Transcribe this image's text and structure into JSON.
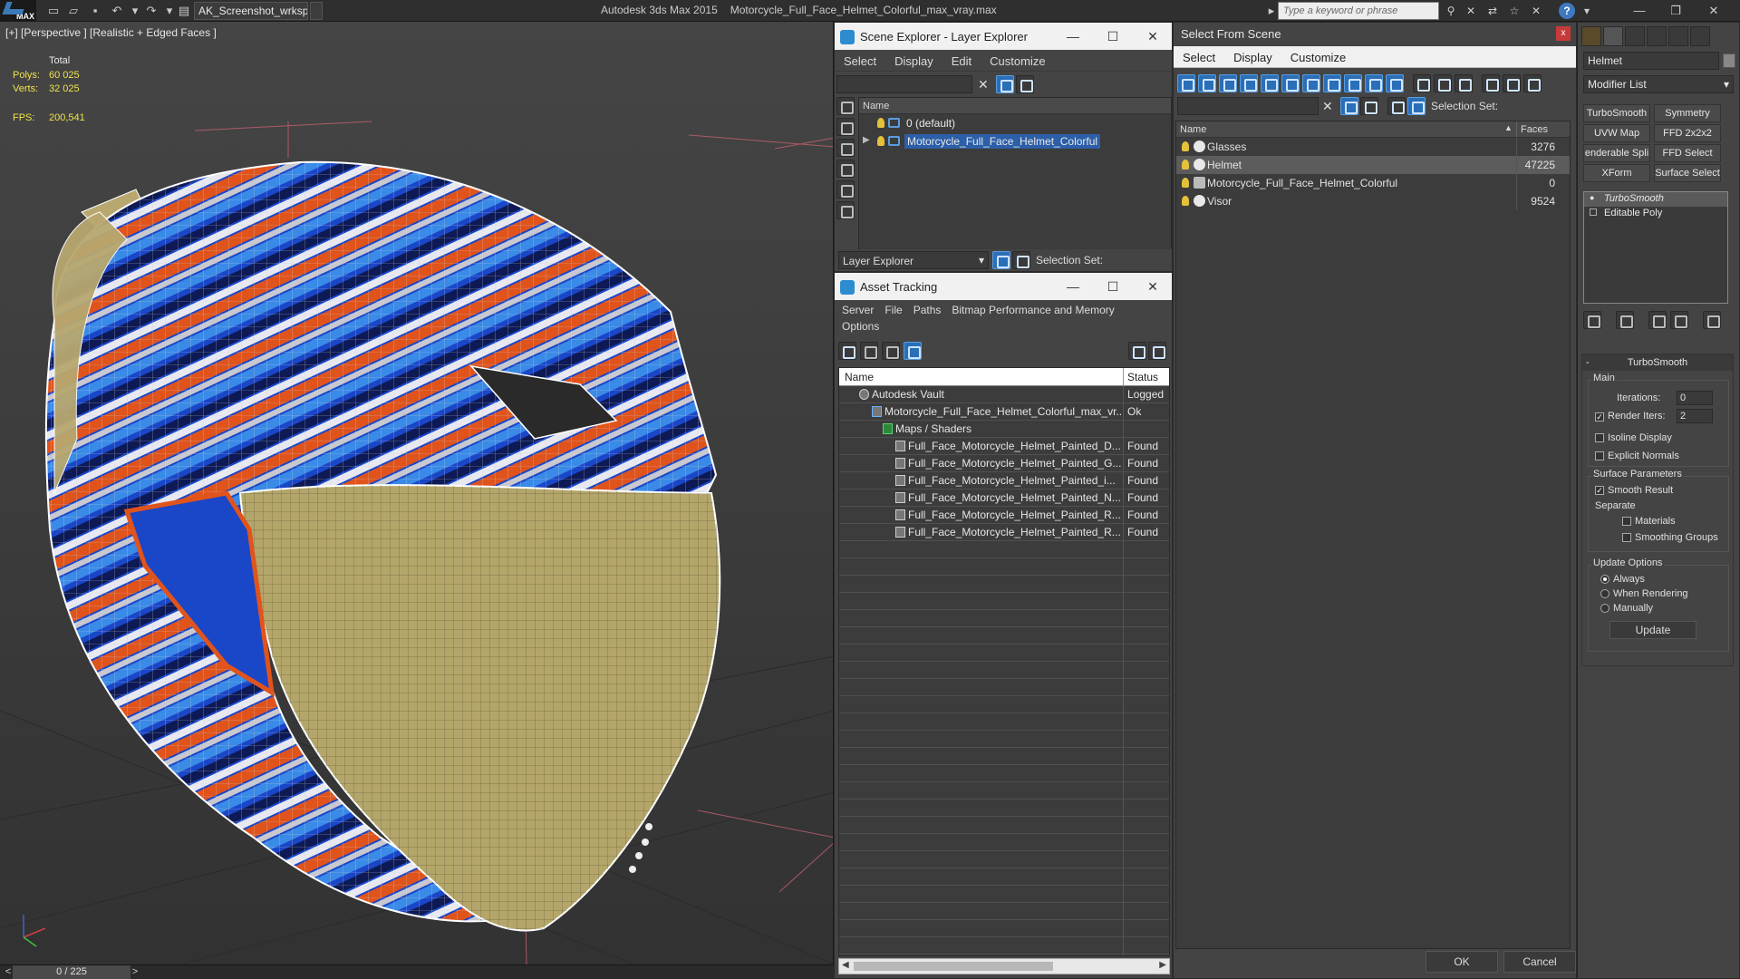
{
  "app": {
    "logo_text": "MAX",
    "workspace": "AK_Screenshot_wrksp",
    "product": "Autodesk 3ds Max  2015",
    "file": "Motorcycle_Full_Face_Helmet_Colorful_max_vray.max",
    "search_placeholder": "Type a keyword or phrase"
  },
  "viewport": {
    "label": "[+] [Perspective ] [Realistic + Edged Faces ]",
    "stats_total_label": "Total",
    "polys_label": "Polys:",
    "polys_value": "60 025",
    "verts_label": "Verts:",
    "verts_value": "32 025",
    "fps_label": "FPS:",
    "fps_value": "200,541",
    "frame_counter": "0 / 225"
  },
  "scene_explorer": {
    "title": "Scene Explorer - Layer Explorer",
    "menu": [
      "Select",
      "Display",
      "Edit",
      "Customize"
    ],
    "column_name": "Name",
    "rows": [
      {
        "label": "0 (default)",
        "selected": false
      },
      {
        "label": "Motorcycle_Full_Face_Helmet_Colorful",
        "selected": true
      }
    ],
    "footer_dropdown": "Layer Explorer",
    "selection_set_label": "Selection Set:"
  },
  "asset_tracking": {
    "title": "Asset Tracking",
    "menu": [
      "Server",
      "File",
      "Paths",
      "Bitmap Performance and Memory"
    ],
    "menu_row2": [
      "Options"
    ],
    "col_name": "Name",
    "col_status": "Status",
    "rows": [
      {
        "name": "Autodesk Vault",
        "status": "Logged",
        "indent": 0
      },
      {
        "name": "Motorcycle_Full_Face_Helmet_Colorful_max_vr...",
        "status": "Ok",
        "indent": 1
      },
      {
        "name": "Maps / Shaders",
        "status": "",
        "indent": 2
      },
      {
        "name": "Full_Face_Motorcycle_Helmet_Painted_D...",
        "status": "Found",
        "indent": 3
      },
      {
        "name": "Full_Face_Motorcycle_Helmet_Painted_G...",
        "status": "Found",
        "indent": 3
      },
      {
        "name": "Full_Face_Motorcycle_Helmet_Painted_i...",
        "status": "Found",
        "indent": 3
      },
      {
        "name": "Full_Face_Motorcycle_Helmet_Painted_N...",
        "status": "Found",
        "indent": 3
      },
      {
        "name": "Full_Face_Motorcycle_Helmet_Painted_R...",
        "status": "Found",
        "indent": 3
      },
      {
        "name": "Full_Face_Motorcycle_Helmet_Painted_R...",
        "status": "Found",
        "indent": 3
      }
    ]
  },
  "select_from_scene": {
    "title": "Select From Scene",
    "close": "x",
    "menu": [
      "Select",
      "Display",
      "Customize"
    ],
    "selection_set_label": "Selection Set:",
    "col_name": "Name",
    "col_faces": "Faces",
    "rows": [
      {
        "name": "Glasses",
        "faces": "3276",
        "highlight": false
      },
      {
        "name": "Helmet",
        "faces": "47225",
        "highlight": true
      },
      {
        "name": "Motorcycle_Full_Face_Helmet_Colorful",
        "faces": "0",
        "highlight": false
      },
      {
        "name": "Visor",
        "faces": "9524",
        "highlight": false
      }
    ],
    "ok_label": "OK",
    "cancel_label": "Cancel"
  },
  "command_panel": {
    "object_name": "Helmet",
    "modifier_list": "Modifier List",
    "mod_buttons": [
      "TurboSmooth",
      "Symmetry",
      "UVW Map",
      "FFD 2x2x2",
      "enderable Spli",
      "FFD Select",
      "XForm",
      "Surface Select"
    ],
    "stack": [
      "TurboSmooth",
      "Editable Poly"
    ],
    "rollout_title": "TurboSmooth",
    "main_label": "Main",
    "iterations_label": "Iterations:",
    "iterations_value": "0",
    "render_iters_label": "Render Iters:",
    "render_iters_value": "2",
    "isoline_label": "Isoline Display",
    "explicit_normals_label": "Explicit Normals",
    "surface_params_label": "Surface Parameters",
    "smooth_result_label": "Smooth Result",
    "separate_label": "Separate",
    "materials_label": "Materials",
    "smoothing_groups_label": "Smoothing Groups",
    "update_options_label": "Update Options",
    "always_label": "Always",
    "when_rendering_label": "When Rendering",
    "manually_label": "Manually",
    "update_button": "Update"
  },
  "colors": {
    "accent_blue": "#2c5fa8",
    "stat_yellow": "#f0e24a",
    "helmet_orange": "#e0541c",
    "helmet_blue": "#1a46c8",
    "visor_tan": "#b4a66a"
  }
}
